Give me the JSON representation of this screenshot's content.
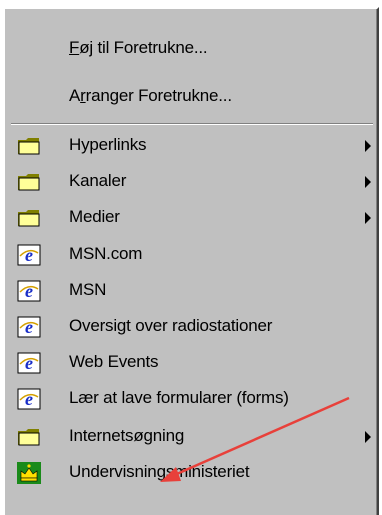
{
  "menu": {
    "items_top": [
      {
        "label_underline": "F",
        "label_rest": "øj til Foretrukne...",
        "icon": "none"
      },
      {
        "label_prefix": "A",
        "label_underline": "r",
        "label_rest": "ranger Foretrukne...",
        "icon": "none"
      }
    ],
    "items": [
      {
        "label": "Hyperlinks",
        "icon": "folder-icon",
        "submenu": true
      },
      {
        "label": "Kanaler",
        "icon": "folder-icon",
        "submenu": true
      },
      {
        "label": "Medier",
        "icon": "folder-icon",
        "submenu": true
      },
      {
        "label": "MSN.com",
        "icon": "ie-icon",
        "submenu": false
      },
      {
        "label": "MSN",
        "icon": "ie-icon",
        "submenu": false
      },
      {
        "label": "Oversigt over radiostationer",
        "icon": "ie-icon",
        "submenu": false
      },
      {
        "label": "Web Events",
        "icon": "ie-icon",
        "submenu": false
      },
      {
        "label": "Lær at lave formularer (forms)",
        "icon": "ie-icon",
        "submenu": false
      },
      {
        "label": "Internetsøgning",
        "icon": "folder-icon",
        "submenu": true
      },
      {
        "label": "Undervisningsministeriet",
        "icon": "crown-icon",
        "submenu": false
      }
    ]
  },
  "colors": {
    "menu_bg": "#c0c0c0",
    "folder": "#ffff99",
    "ie_blue": "#1a2fc8",
    "crown_bg": "#1a8a1a",
    "annotation_arrow": "#e8403a"
  }
}
